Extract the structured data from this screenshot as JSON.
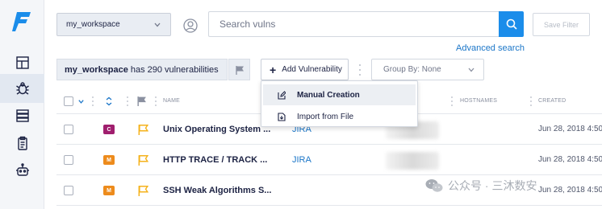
{
  "sidebar": {
    "logo": "F",
    "items": [
      {
        "icon": "dashboard-icon"
      },
      {
        "icon": "bug-icon",
        "active": true
      },
      {
        "icon": "server-icon"
      },
      {
        "icon": "clipboard-icon"
      },
      {
        "icon": "robot-icon"
      }
    ]
  },
  "header": {
    "workspace": "my_workspace",
    "search_placeholder": "Search vulns",
    "save_filter": "Save Filter",
    "advanced_search": "Advanced search"
  },
  "toolbar": {
    "workspace_name": "my_workspace",
    "has_text": "has",
    "count": "290",
    "count_suffix": "vulnerabilities",
    "add_vulnerability": "Add Vulnerability",
    "group_by": "Group By: None"
  },
  "menu": {
    "items": [
      {
        "label": "Manual Creation",
        "icon": "edit-icon"
      },
      {
        "label": "Import from File",
        "icon": "file-import-icon"
      }
    ]
  },
  "table": {
    "headers": {
      "name": "NAME",
      "hostnames": "HOSTNAMES",
      "created": "CREATED"
    },
    "rows": [
      {
        "severity": "C",
        "severity_color": "#a01e6e",
        "name": "Unix Operating System ...",
        "link": "JIRA",
        "created": "Jun 28, 2018 4:50"
      },
      {
        "severity": "M",
        "severity_color": "#ed8b1c",
        "name": "HTTP TRACE / TRACK ...",
        "link": "JIRA",
        "created": "Jun 28, 2018 4:50"
      },
      {
        "severity": "M",
        "severity_color": "#ed8b1c",
        "name": "SSH Weak Algorithms S...",
        "link": "",
        "created": "Jun 28, 2018 4:50"
      }
    ]
  },
  "watermark": "公众号 · 三沐数安",
  "colors": {
    "accent": "#1b8dea",
    "link": "#1b76c8",
    "flag": "#f5b21b"
  }
}
